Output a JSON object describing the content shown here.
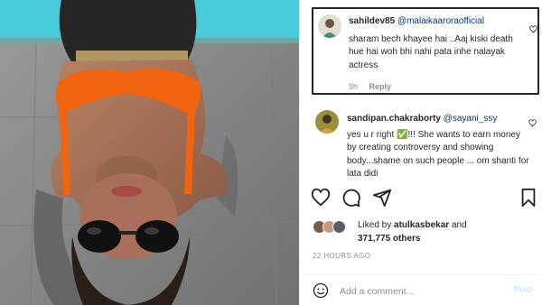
{
  "comments": [
    {
      "username": "sahildev85",
      "mention": "@malaikaarora­official",
      "text": "sharam bech khayee hai ..Aaj kiski death hue hai woh bhi nahi pata inhe nalayak actress",
      "time": "9h",
      "reply_label": "Reply"
    },
    {
      "username": "sandipan.chakraborty",
      "mention": "@sayani_ssy",
      "text_part1": "yes u r right ",
      "checkmark": "✅",
      "text_part2": "!!! She wants to earn money by creating controversy and showing body...shame on such people ... om shanti for lata didi"
    }
  ],
  "likes": {
    "liked_by_label": "Liked by",
    "liked_by_user": "atulkasbekar",
    "and_label": "and",
    "count_text": "371,775 others"
  },
  "time_ago": "22 HOURS AGO",
  "add_comment": {
    "placeholder": "Add a comment...",
    "post_label": "Post"
  },
  "icons": {
    "like": "heart-icon",
    "comment": "comment-icon",
    "share": "share-icon",
    "save": "bookmark-icon",
    "emoji": "emoji-icon"
  },
  "colors": {
    "bikini": "#f0640f",
    "pool": "#3ec7d8",
    "link": "#00376b",
    "post_button": "#b2dffc"
  }
}
